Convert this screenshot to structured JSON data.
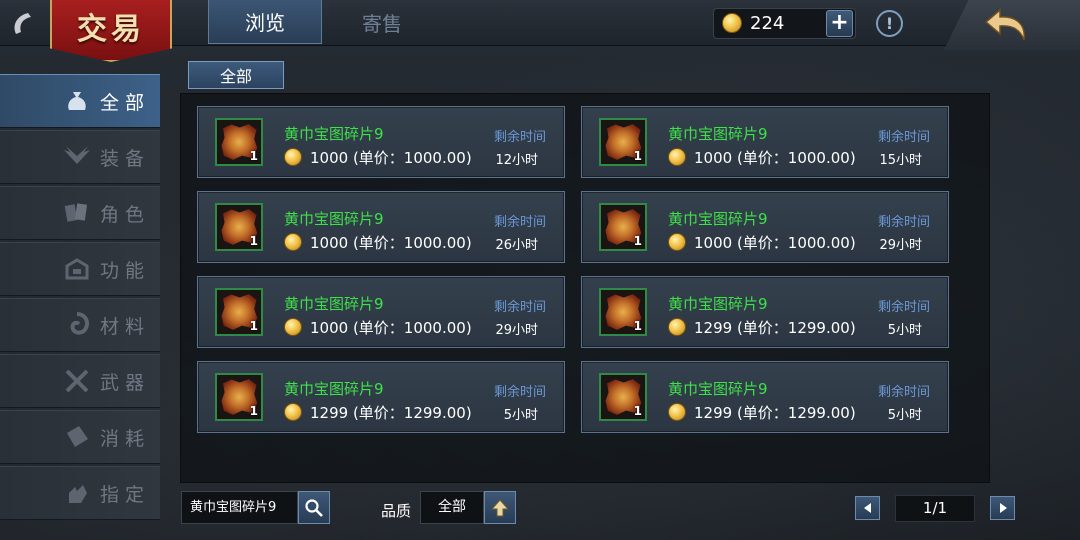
{
  "header": {
    "banner_title": "交易",
    "tabs": [
      {
        "label": "浏览",
        "active": true
      },
      {
        "label": "寄售",
        "active": false
      }
    ],
    "coins": "224",
    "plus_label": "+",
    "info_label": "!"
  },
  "sidebar": {
    "items": [
      {
        "label": "全部",
        "icon": "money-bag-icon",
        "active": true
      },
      {
        "label": "装备",
        "icon": "wings-icon",
        "active": false
      },
      {
        "label": "角色",
        "icon": "cards-icon",
        "active": false
      },
      {
        "label": "功能",
        "icon": "chest-icon",
        "active": false
      },
      {
        "label": "材料",
        "icon": "swirl-icon",
        "active": false
      },
      {
        "label": "武器",
        "icon": "crossed-swords-icon",
        "active": false
      },
      {
        "label": "消耗",
        "icon": "scroll-icon",
        "active": false
      },
      {
        "label": "指定",
        "icon": "hand-icon",
        "active": false
      }
    ]
  },
  "filter": {
    "label": "全部"
  },
  "listings": [
    {
      "name": "黄巾宝图碎片9",
      "count": "1",
      "price": "1000 (单价：1000.00)",
      "time_label": "剩余时间",
      "time": "12小时"
    },
    {
      "name": "黄巾宝图碎片9",
      "count": "1",
      "price": "1000 (单价：1000.00)",
      "time_label": "剩余时间",
      "time": "15小时"
    },
    {
      "name": "黄巾宝图碎片9",
      "count": "1",
      "price": "1000 (单价：1000.00)",
      "time_label": "剩余时间",
      "time": "26小时"
    },
    {
      "name": "黄巾宝图碎片9",
      "count": "1",
      "price": "1000 (单价：1000.00)",
      "time_label": "剩余时间",
      "time": "29小时"
    },
    {
      "name": "黄巾宝图碎片9",
      "count": "1",
      "price": "1000 (单价：1000.00)",
      "time_label": "剩余时间",
      "time": "29小时"
    },
    {
      "name": "黄巾宝图碎片9",
      "count": "1",
      "price": "1299 (单价：1299.00)",
      "time_label": "剩余时间",
      "time": "5小时"
    },
    {
      "name": "黄巾宝图碎片9",
      "count": "1",
      "price": "1299 (单价：1299.00)",
      "time_label": "剩余时间",
      "time": "5小时"
    },
    {
      "name": "黄巾宝图碎片9",
      "count": "1",
      "price": "1299 (单价：1299.00)",
      "time_label": "剩余时间",
      "time": "5小时"
    }
  ],
  "bottom": {
    "search_value": "黄巾宝图碎片9",
    "quality_label": "品质",
    "quality_value": "全部",
    "page": "1/1"
  },
  "colors": {
    "accent_blue": "#3d6188",
    "item_name_green": "#3fe04a",
    "time_label_blue": "#6b98d6",
    "banner_red": "#a81f1f"
  }
}
